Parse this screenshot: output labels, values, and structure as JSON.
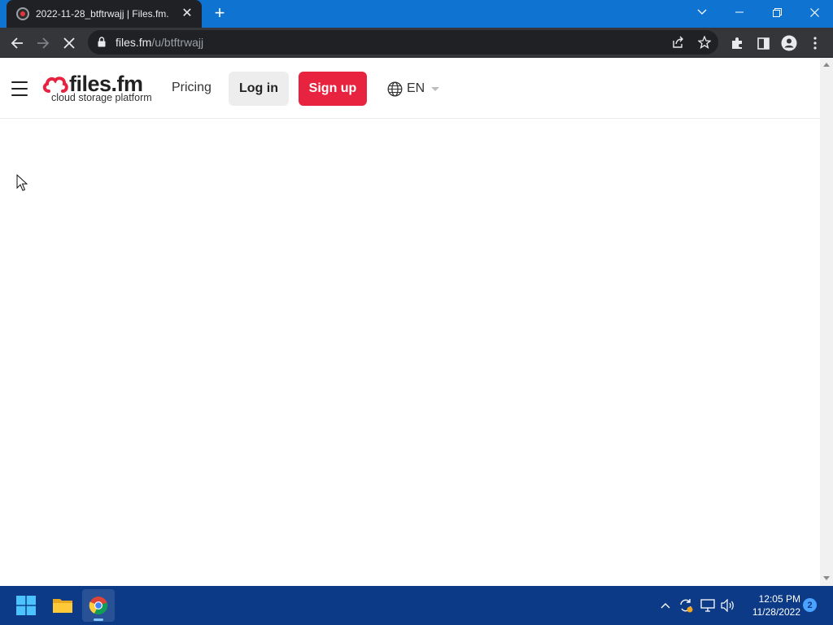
{
  "browser": {
    "tab": {
      "title": "2022-11-28_btftrwajj | Files.fm.",
      "close_glyph": "✕"
    },
    "new_tab_glyph": "+",
    "window_controls": [
      "chevron-down-icon",
      "minimize-icon",
      "restore-icon",
      "close-icon"
    ],
    "omnibox": {
      "domain": "files.fm",
      "path": "/u/btftrwajj"
    },
    "toolbar_icons": [
      "back-arrow-icon",
      "forward-arrow-icon",
      "stop-loading-icon",
      "lock-icon",
      "share-icon",
      "star-icon",
      "extensions-icon",
      "side-panel-icon",
      "profile-icon",
      "menu-dots-icon"
    ]
  },
  "site": {
    "logo": {
      "name": "files.fm",
      "tagline": "cloud storage platform"
    },
    "nav": {
      "pricing": "Pricing",
      "login": "Log in",
      "signup": "Sign up",
      "language": "EN"
    },
    "colors": {
      "brand_red": "#e8233f",
      "login_bg": "#ededed"
    }
  },
  "taskbar": {
    "apps": [
      "windows-start-icon",
      "file-explorer-icon",
      "chrome-icon"
    ],
    "tray": [
      "chevron-up-icon",
      "sync-icon",
      "network-icon",
      "volume-icon"
    ],
    "clock": {
      "time": "12:05 PM",
      "date": "11/28/2022"
    },
    "notification_count": "2",
    "color": "#0c3a87"
  }
}
